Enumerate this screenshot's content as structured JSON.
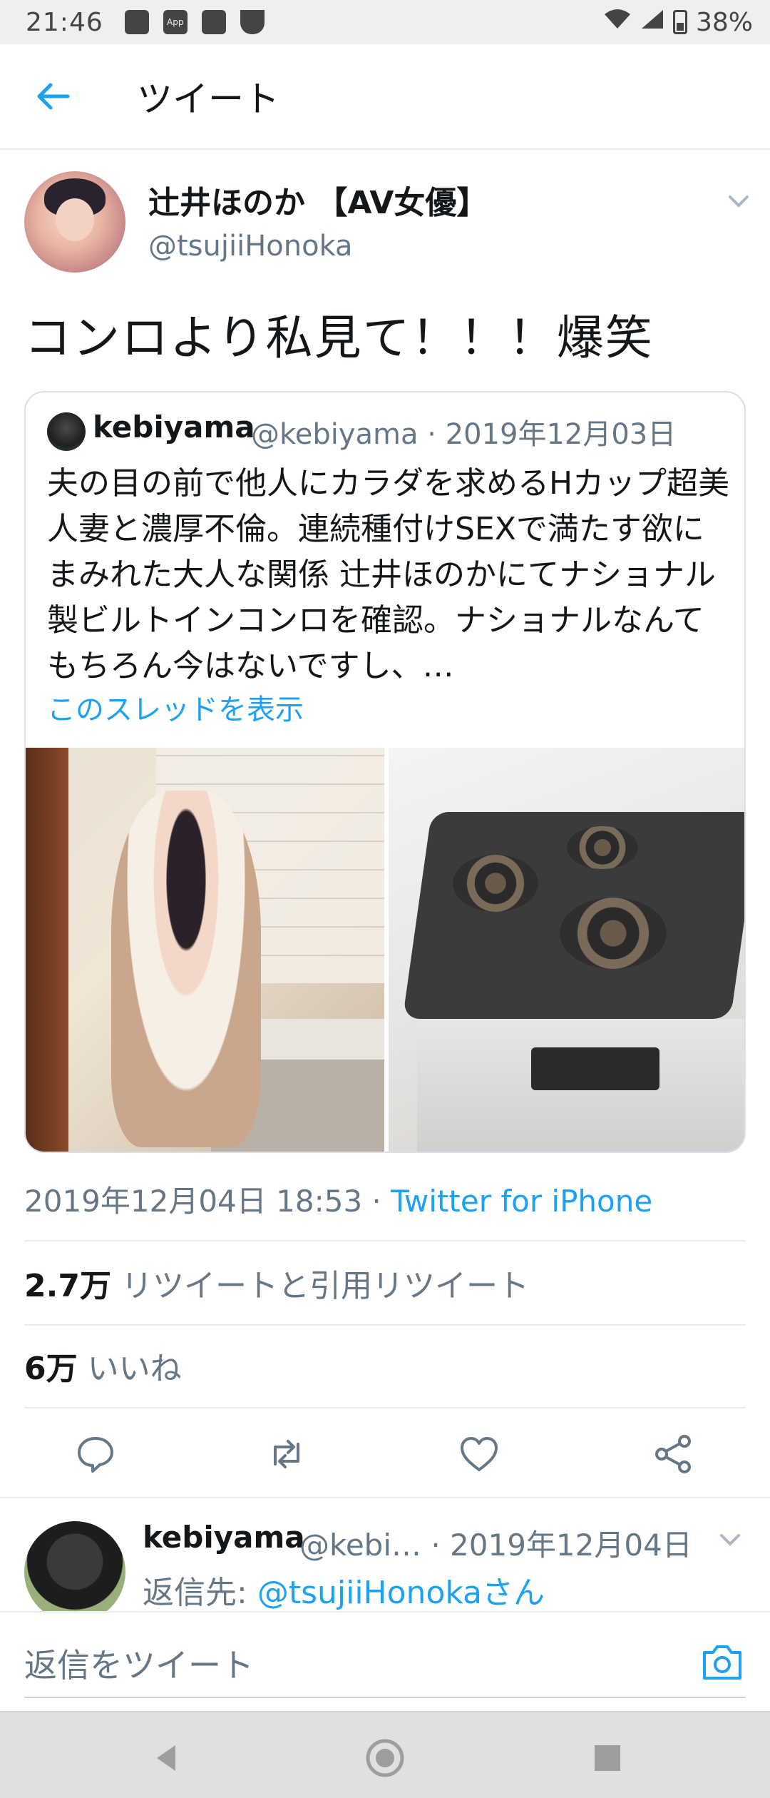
{
  "status_bar": {
    "time": "21:46",
    "app_icon_label": "App",
    "battery": "38%",
    "icons": [
      "image-icon",
      "app-icon",
      "vibrate-icon",
      "shield-icon",
      "wifi-icon",
      "signal-icon",
      "battery-icon"
    ]
  },
  "header": {
    "title": "ツイート",
    "back_icon": "back-arrow-icon"
  },
  "tweet": {
    "author_name": "辻井ほのか 【AV女優】",
    "author_handle": "@tsujiiHonoka",
    "text": "コンロより私見て！！！爆笑",
    "timestamp": "2019年12月04日 18:53 · ",
    "source": "Twitter for iPhone",
    "retweets_count": "2.7万",
    "retweets_label": "リツイートと引用リツイート",
    "likes_count": "6万",
    "likes_label": "いいね"
  },
  "quoted_tweet": {
    "author_name": "kebiyama",
    "meta": "@kebiyama · 2019年12月03日",
    "body": "夫の目の前で他人にカラダを求めるHカップ超美人妻と濃厚不倫。連続種付けSEXで満たす欲にまみれた大人な関係 辻井ほのかにてナショナル製ビルトインコンロを確認。ナショナルなんてもちろん今はないですし、…",
    "show_thread": "このスレッドを表示"
  },
  "reply": {
    "author_name": "kebiyama",
    "meta": "@kebi… · 2019年12月04日",
    "reply_to_prefix": "返信先: ",
    "reply_to_mention": "@tsujiiHonokaさん"
  },
  "compose": {
    "placeholder": "返信をツイート"
  },
  "colors": {
    "accent": "#1da1f2",
    "text_primary": "#14171a",
    "text_secondary": "#657786",
    "divider": "#e6ecf0"
  }
}
